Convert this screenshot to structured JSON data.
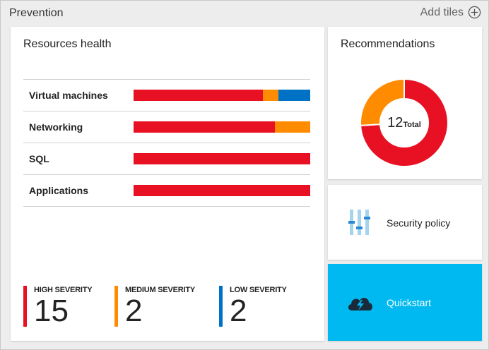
{
  "header": {
    "title": "Prevention",
    "add_tiles_label": "Add tiles"
  },
  "resources_health": {
    "title": "Resources health",
    "rows": [
      {
        "label": "Virtual machines",
        "segments": [
          {
            "color": "#e81123",
            "fraction": 0.73
          },
          {
            "color": "#ff8c00",
            "fraction": 0.09
          },
          {
            "color": "#0072c6",
            "fraction": 0.18
          }
        ]
      },
      {
        "label": "Networking",
        "segments": [
          {
            "color": "#e81123",
            "fraction": 0.8
          },
          {
            "color": "#ff8c00",
            "fraction": 0.2
          }
        ]
      },
      {
        "label": "SQL",
        "segments": [
          {
            "color": "#e81123",
            "fraction": 1.0
          }
        ]
      },
      {
        "label": "Applications",
        "segments": [
          {
            "color": "#e81123",
            "fraction": 1.0
          }
        ]
      }
    ],
    "severity": [
      {
        "label": "HIGH SEVERITY",
        "count": "15",
        "color": "#e81123"
      },
      {
        "label": "MEDIUM SEVERITY",
        "count": "2",
        "color": "#ff8c00"
      },
      {
        "label": "LOW SEVERITY",
        "count": "2",
        "color": "#0072c6"
      }
    ]
  },
  "recommendations": {
    "title": "Recommendations",
    "total": "12",
    "total_label": "Total",
    "slices": [
      {
        "color": "#e81123",
        "fraction": 0.74
      },
      {
        "color": "#ff8c00",
        "fraction": 0.26
      }
    ]
  },
  "security_policy": {
    "label": "Security policy",
    "icon": "sliders-icon"
  },
  "quickstart": {
    "label": "Quickstart",
    "icon": "cloud-bolt-icon",
    "color": "#00b9f1"
  }
}
